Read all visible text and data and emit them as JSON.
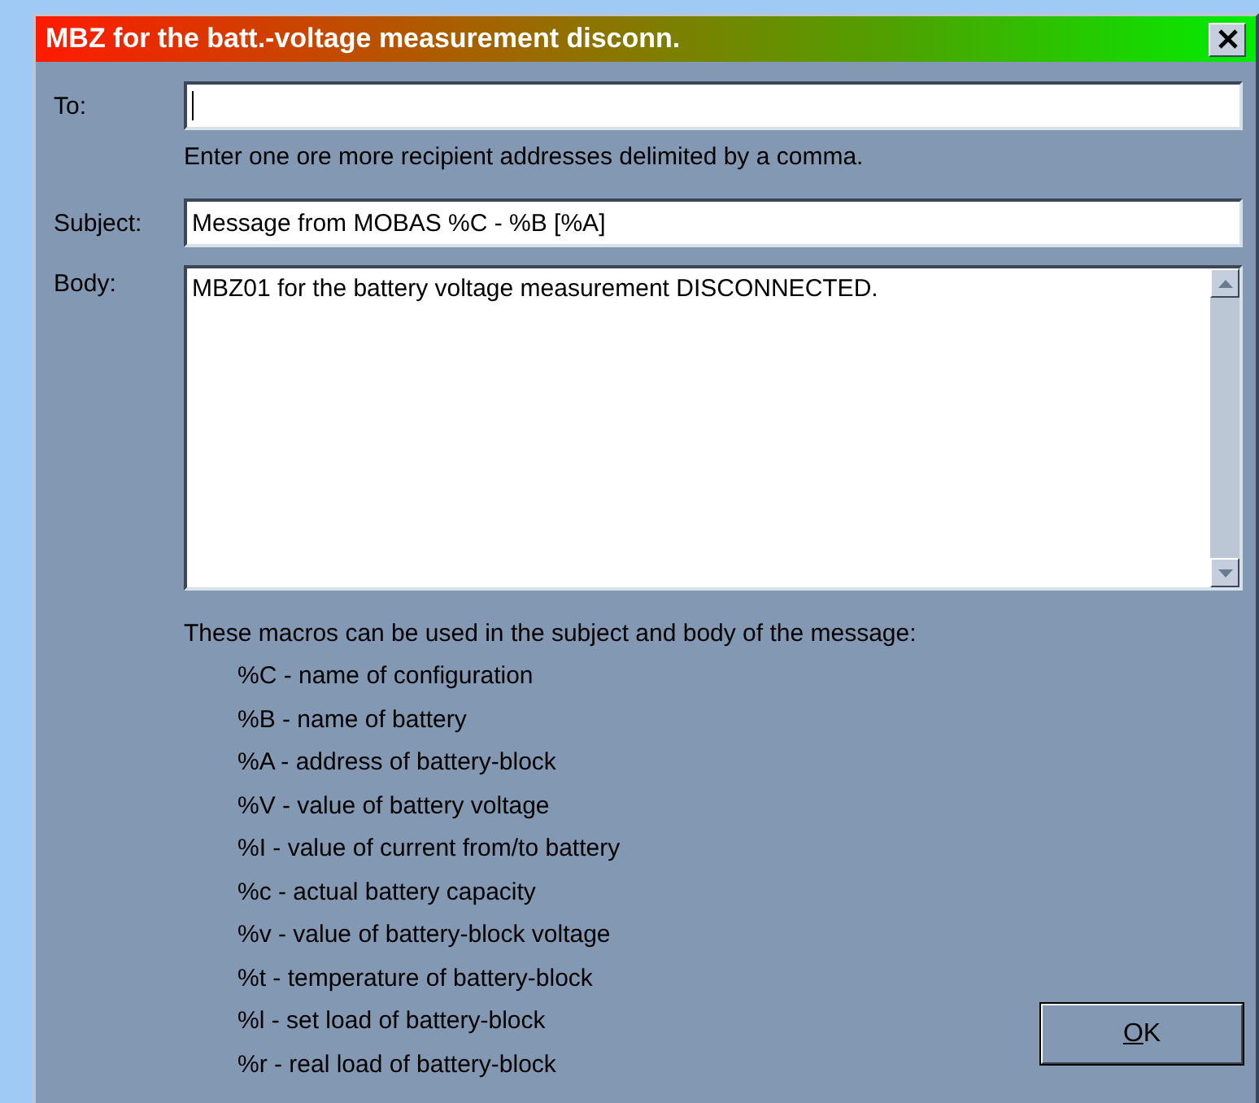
{
  "window": {
    "title": "MBZ for the batt.-voltage measurement disconn."
  },
  "to": {
    "label": "To:",
    "focused": true,
    "hint": "Enter one ore more recipient addresses delimited by a comma."
  },
  "subject": {
    "label": "Subject:",
    "value": "Message from MOBAS %C - %B [%A]"
  },
  "body": {
    "label": "Body:",
    "value": "MBZ01 for the battery voltage measurement DISCONNECTED."
  },
  "macros": {
    "intro": "These macros can be used in the subject and body of the message:",
    "items": [
      "%C - name of configuration",
      "%B - name of battery",
      "%A - address of battery-block",
      "%V - value of battery voltage",
      "%I - value of current from/to battery",
      "%c - actual battery capacity",
      "%v - value of battery-block voltage",
      "%t - temperature of battery-block",
      "%l - set load of battery-block",
      "%r - real load of battery-block"
    ]
  },
  "buttons": [
    {
      "label": "OK",
      "default": true
    }
  ]
}
